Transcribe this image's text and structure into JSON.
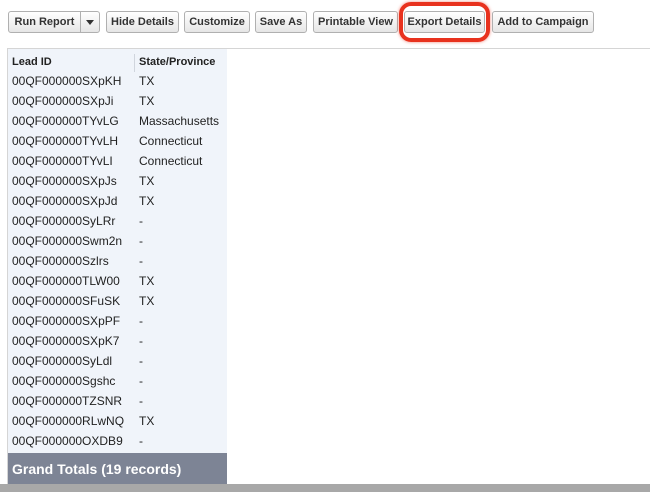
{
  "toolbar": {
    "run_report": "Run Report",
    "hide_details": "Hide Details",
    "customize": "Customize",
    "save_as": "Save As",
    "printable_view": "Printable View",
    "export_details": "Export Details",
    "add_to_campaign": "Add to Campaign"
  },
  "table": {
    "headers": [
      "Lead ID",
      "State/Province"
    ],
    "rows": [
      [
        "00QF000000SXpKH",
        "TX"
      ],
      [
        "00QF000000SXpJi",
        "TX"
      ],
      [
        "00QF000000TYvLG",
        "Massachusetts"
      ],
      [
        "00QF000000TYvLH",
        "Connecticut"
      ],
      [
        "00QF000000TYvLI",
        "Connecticut"
      ],
      [
        "00QF000000SXpJs",
        "TX"
      ],
      [
        "00QF000000SXpJd",
        "TX"
      ],
      [
        "00QF000000SyLRr",
        "-"
      ],
      [
        "00QF000000Swm2n",
        "-"
      ],
      [
        "00QF000000Szlrs",
        "-"
      ],
      [
        "00QF000000TLW00",
        "TX"
      ],
      [
        "00QF000000SFuSK",
        "TX"
      ],
      [
        "00QF000000SXpPF",
        "-"
      ],
      [
        "00QF000000SXpK7",
        "-"
      ],
      [
        "00QF000000SyLdl",
        "-"
      ],
      [
        "00QF000000Sgshc",
        "-"
      ],
      [
        "00QF000000TZSNR",
        "-"
      ],
      [
        "00QF000000RLwNQ",
        "TX"
      ],
      [
        "00QF000000OXDB9",
        "-"
      ]
    ],
    "grand_totals": "Grand Totals (19 records)"
  },
  "colors": {
    "highlight": "#e8321e",
    "totals_bg": "#7d8495",
    "column_shade": "#f0f4fa"
  }
}
